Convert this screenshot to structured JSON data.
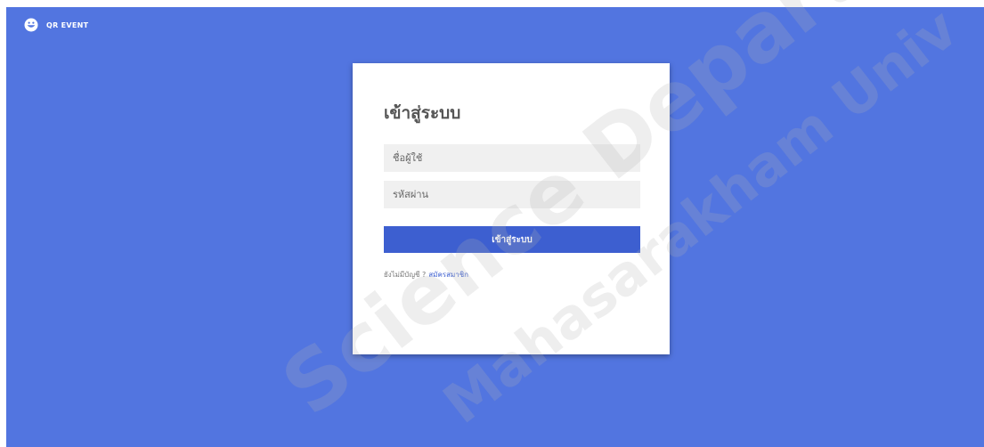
{
  "brand": {
    "name": "QR EVENT",
    "icon": "smiley-logo-icon"
  },
  "login": {
    "title": "เข้าสู่ระบบ",
    "username_placeholder": "ชื่อผู้ใช้",
    "password_placeholder": "รหัสผ่าน",
    "submit_label": "เข้าสู่ระบบ",
    "signup_prompt": "ยังไม่มีบัญชี ?",
    "signup_link": "สมัครสมาชิก"
  },
  "watermark": {
    "line1": "Science Department",
    "line2": "Mahasarakham Univ"
  },
  "colors": {
    "background": "#5275e0",
    "primary_button": "#3d5fd0",
    "card": "#ffffff",
    "input_background": "#f0f0f0"
  }
}
